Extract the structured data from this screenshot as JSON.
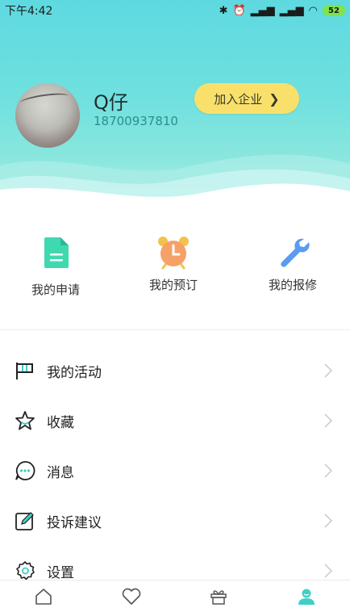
{
  "status_bar": {
    "time": "下午4:42",
    "icons": [
      "bluetooth-icon",
      "alarm-icon",
      "signal-icon",
      "signal-icon",
      "wifi-icon"
    ],
    "battery": "52"
  },
  "profile": {
    "name": "Q仔",
    "phone": "18700937810",
    "join_button": "加入企业",
    "join_chevron": "❯"
  },
  "quick_actions": [
    {
      "label": "我的申请",
      "icon": "document-icon",
      "color": "#3fd9b0"
    },
    {
      "label": "我的预订",
      "icon": "alarm-clock-icon",
      "color": "#f5a167"
    },
    {
      "label": "我的报修",
      "icon": "wrench-icon",
      "color": "#5a9cf0"
    }
  ],
  "menu": [
    {
      "label": "我的活动",
      "icon": "flag-icon"
    },
    {
      "label": "收藏",
      "icon": "star-icon"
    },
    {
      "label": "消息",
      "icon": "chat-bubble-icon"
    },
    {
      "label": "投诉建议",
      "icon": "edit-icon"
    },
    {
      "label": "设置",
      "icon": "gear-icon"
    }
  ],
  "tab_bar": {
    "tabs": [
      {
        "icon": "home-icon",
        "active": false
      },
      {
        "icon": "heart-icon",
        "active": false
      },
      {
        "icon": "gift-icon",
        "active": false
      },
      {
        "icon": "user-icon",
        "active": true
      }
    ],
    "active_color": "#3fcfc6"
  },
  "colors": {
    "header_gradient_top": "#5ed9e0",
    "accent_teal": "#2a8f8c",
    "join_button": "#f9e06b"
  }
}
